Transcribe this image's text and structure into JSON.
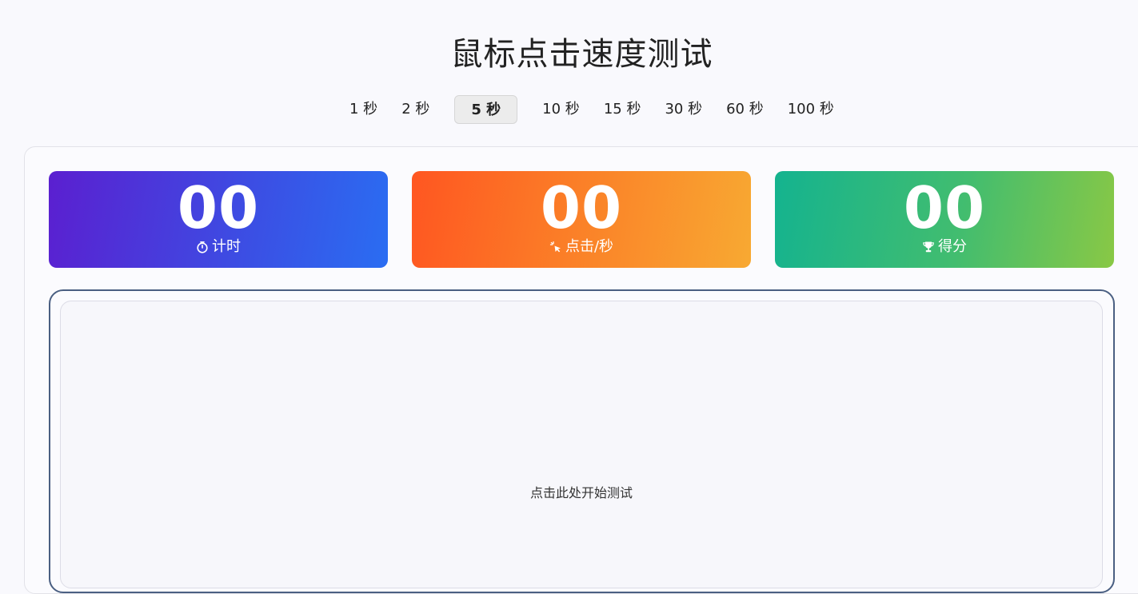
{
  "title": "鼠标点击速度测试",
  "duration_tabs": [
    {
      "label": "1 秒",
      "active": false
    },
    {
      "label": "2 秒",
      "active": false
    },
    {
      "label": "5 秒",
      "active": true
    },
    {
      "label": "10 秒",
      "active": false
    },
    {
      "label": "15 秒",
      "active": false
    },
    {
      "label": "30 秒",
      "active": false
    },
    {
      "label": "60 秒",
      "active": false
    },
    {
      "label": "100 秒",
      "active": false
    }
  ],
  "stats": {
    "timer": {
      "value": "00",
      "label": "计时",
      "icon": "stopwatch-icon"
    },
    "cps": {
      "value": "00",
      "label": "点击/秒",
      "icon": "cursor-click-icon"
    },
    "score": {
      "value": "00",
      "label": "得分",
      "icon": "trophy-icon"
    }
  },
  "click_area": {
    "hint": "点击此处开始测试"
  },
  "colors": {
    "timer_gradient": [
      "#5b1fd0",
      "#2a6df2"
    ],
    "cps_gradient": [
      "#ff5621",
      "#f8a932"
    ],
    "score_gradient": [
      "#14b38f",
      "#89c845"
    ],
    "click_area_border": "#4a5f82"
  }
}
